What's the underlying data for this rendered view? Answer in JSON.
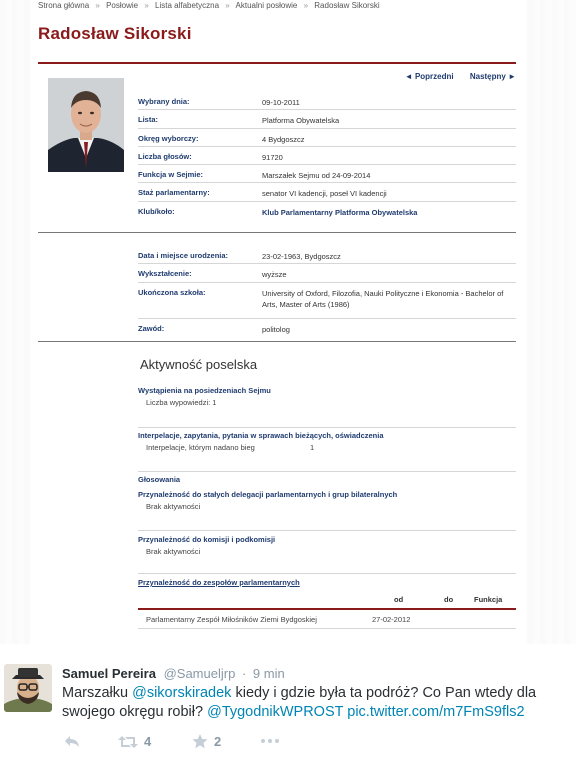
{
  "profile_page": {
    "breadcrumb": [
      "Strona główna",
      "Posłowie",
      "Lista alfabetyczna",
      "Aktualni posłowie",
      "Radosław Sikorski"
    ],
    "breadcrumb_sep": "»",
    "name": "Radosław Sikorski",
    "nav": {
      "prev": "◄ Poprzedni",
      "next": "Następny ►"
    },
    "details": [
      {
        "label": "Wybrany dnia:",
        "value": "09-10-2011"
      },
      {
        "label": "Lista:",
        "value": "Platforma Obywatelska"
      },
      {
        "label": "Okręg wyborczy:",
        "value": "4  Bydgoszcz"
      },
      {
        "label": "Liczba głosów:",
        "value": "91720"
      },
      {
        "label": "Funkcja w Sejmie:",
        "value": "Marszałek Sejmu od 24-09-2014"
      },
      {
        "label": "Staż parlamentarny:",
        "value": "senator VI kadencji, poseł VI kadencji"
      },
      {
        "label": "Klub/koło:",
        "value": "Klub Parlamentarny Platforma Obywatelska"
      }
    ],
    "personal": [
      {
        "label": "Data i miejsce urodzenia:",
        "value": "23-02-1963, Bydgoszcz"
      },
      {
        "label": "Wykształcenie:",
        "value": "wyższe"
      },
      {
        "label": "Ukończona szkoła:",
        "value": "University of Oxford, Filozofia, Nauki Polityczne i Ekonomia - Bachelor of Arts, Master of Arts (1986)"
      },
      {
        "label": "Zawód:",
        "value": "politolog"
      }
    ],
    "activity": {
      "title": "Aktywność poselska",
      "speeches": {
        "heading": "Wystąpienia na posiedzeniach Sejmu",
        "sub": "Liczba wypowiedzi: 1"
      },
      "interpellations": {
        "heading": "Interpelacje, zapytania, pytania w sprawach bieżących, oświadczenia",
        "sub": "Interpelacje, którym nadano bieg",
        "count": "1"
      },
      "votes": {
        "heading": "Głosowania"
      },
      "delegations": {
        "heading": "Przynależność do stałych delegacji parlamentarnych i grup bilateralnych",
        "sub": "Brak aktywności"
      },
      "committees": {
        "heading": "Przynależność do komisji i podkomisji",
        "sub": "Brak aktywności"
      },
      "teams": {
        "heading": "Przynależność do zespołów parlamentarnych",
        "columns": [
          "od",
          "do",
          "Funkcja"
        ],
        "rows": [
          {
            "name": "Parlamentarny Zespół Miłośników Ziemi Bydgoskiej",
            "from": "27-02-2012"
          }
        ]
      }
    }
  },
  "tweet": {
    "display_name": "Samuel Pereira",
    "screen_name": "@Samueljrp",
    "separator": "·",
    "time": "9 min",
    "text_parts": {
      "p1": "Marszałku ",
      "mention1": "@sikorskiradek",
      "p2": " kiedy i gdzie była ta podróż? Co Pan wtedy dla swojego okręgu robił? ",
      "mention2": "@TygodnikWPROST",
      "p3": " ",
      "link": "pic.twitter.com/m7FmS9fls2"
    },
    "retweets": "4",
    "favorites": "2"
  },
  "colors": {
    "sejm_red": "#8b1a1a",
    "sejm_blue": "#1f3b6f",
    "twitter_link": "#0084b4",
    "twitter_gray": "#8899a6"
  }
}
